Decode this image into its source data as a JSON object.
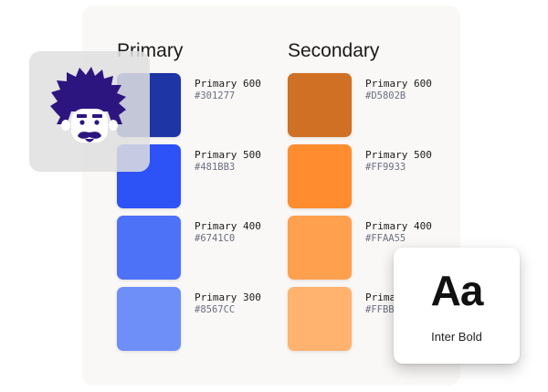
{
  "primary": {
    "title": "Primary",
    "swatches": [
      {
        "name": "Primary 600",
        "hex": "#301277",
        "color": "#1E35A6"
      },
      {
        "name": "Primary 500",
        "hex": "#481BB3",
        "color": "#2D52F5"
      },
      {
        "name": "Primary 400",
        "hex": "#6741C0",
        "color": "#4E72F7"
      },
      {
        "name": "Primary 300",
        "hex": "#8567CC",
        "color": "#6E8EF8"
      }
    ]
  },
  "secondary": {
    "title": "Secondary",
    "swatches": [
      {
        "name": "Primary 600",
        "hex": "#D5802B",
        "color": "#D07024"
      },
      {
        "name": "Primary 500",
        "hex": "#FF9933",
        "color": "#FF8C2E"
      },
      {
        "name": "Primary 400",
        "hex": "#FFAA55",
        "color": "#FFA04F"
      },
      {
        "name": "Prima",
        "hex": "#FFBB",
        "color": "#FFB36E"
      }
    ]
  },
  "avatar": {
    "icon": "einstein-avatar-icon",
    "color": "#2D1580"
  },
  "typography": {
    "sample": "Aa",
    "font_name": "Inter Bold"
  }
}
